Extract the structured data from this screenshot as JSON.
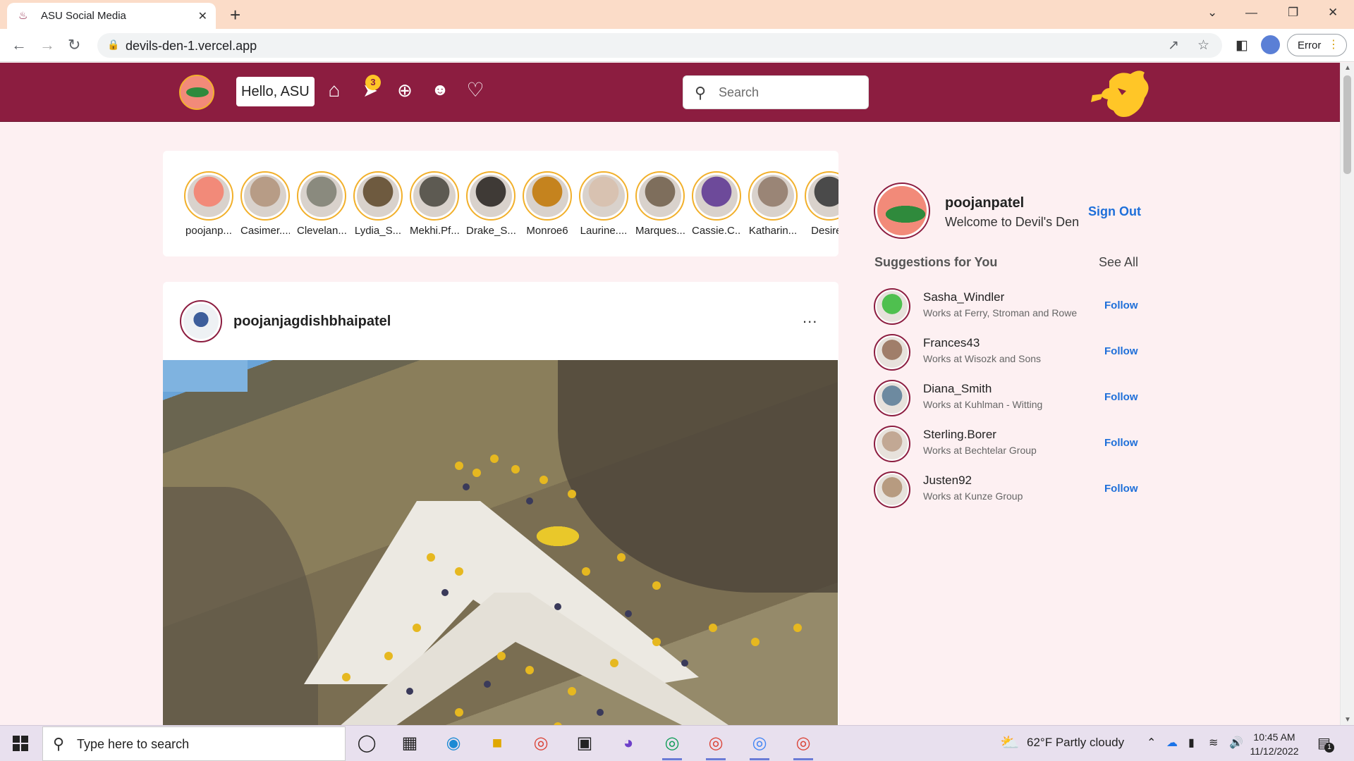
{
  "browser": {
    "tab_title": "ASU Social Media",
    "url": "devils-den-1.vercel.app",
    "profile_status": "Error"
  },
  "header": {
    "greeting": "Hello, ASU",
    "notification_count": "3",
    "search_placeholder": "Search",
    "icons": [
      "home-icon",
      "messages-icon",
      "add-post-icon",
      "people-icon",
      "heart-icon"
    ],
    "brand_color": "#8c1d40",
    "accent_color": "#ffc627"
  },
  "stories": [
    {
      "name": "poojanp...",
      "color": "#f28a79"
    },
    {
      "name": "Casimer....",
      "color": "#b79c86"
    },
    {
      "name": "Clevelan...",
      "color": "#8a8a7e"
    },
    {
      "name": "Lydia_S...",
      "color": "#6e5a3f"
    },
    {
      "name": "Mekhi.Pf...",
      "color": "#5d5a52"
    },
    {
      "name": "Drake_S...",
      "color": "#3f3a36"
    },
    {
      "name": "Monroe6",
      "color": "#c5831e"
    },
    {
      "name": "Laurine....",
      "color": "#d8c2b1"
    },
    {
      "name": "Marques...",
      "color": "#7e6e5c"
    },
    {
      "name": "Cassie.C...",
      "color": "#6d4a9a"
    },
    {
      "name": "Katharin...",
      "color": "#9a8576"
    },
    {
      "name": "Desiree",
      "color": "#4a4a4a"
    }
  ],
  "post": {
    "username": "poojanjagdishbhaipatel",
    "more_label": "..."
  },
  "sidebar": {
    "username": "poojanpatel",
    "welcome": "Welcome to Devil's Den",
    "sign_out": "Sign Out",
    "suggestions_title": "Suggestions for You",
    "see_all": "See All",
    "suggestions": [
      {
        "name": "Sasha_Windler",
        "work": "Works at Ferry, Stroman and Rowe",
        "follow": "Follow",
        "color": "#4fc04f"
      },
      {
        "name": "Frances43",
        "work": "Works at Wisozk and Sons",
        "follow": "Follow",
        "color": "#a07e6a"
      },
      {
        "name": "Diana_Smith",
        "work": "Works at Kuhlman - Witting",
        "follow": "Follow",
        "color": "#6d8aa0"
      },
      {
        "name": "Sterling.Borer",
        "work": "Works at Bechtelar Group",
        "follow": "Follow",
        "color": "#c2a894"
      },
      {
        "name": "Justen92",
        "work": "Works at Kunze Group",
        "follow": "Follow",
        "color": "#b79b80"
      }
    ]
  },
  "taskbar": {
    "search_placeholder": "Type here to search",
    "weather": "62°F  Partly cloudy",
    "time": "10:45 AM",
    "date": "11/12/2022",
    "notification_count": "1"
  }
}
